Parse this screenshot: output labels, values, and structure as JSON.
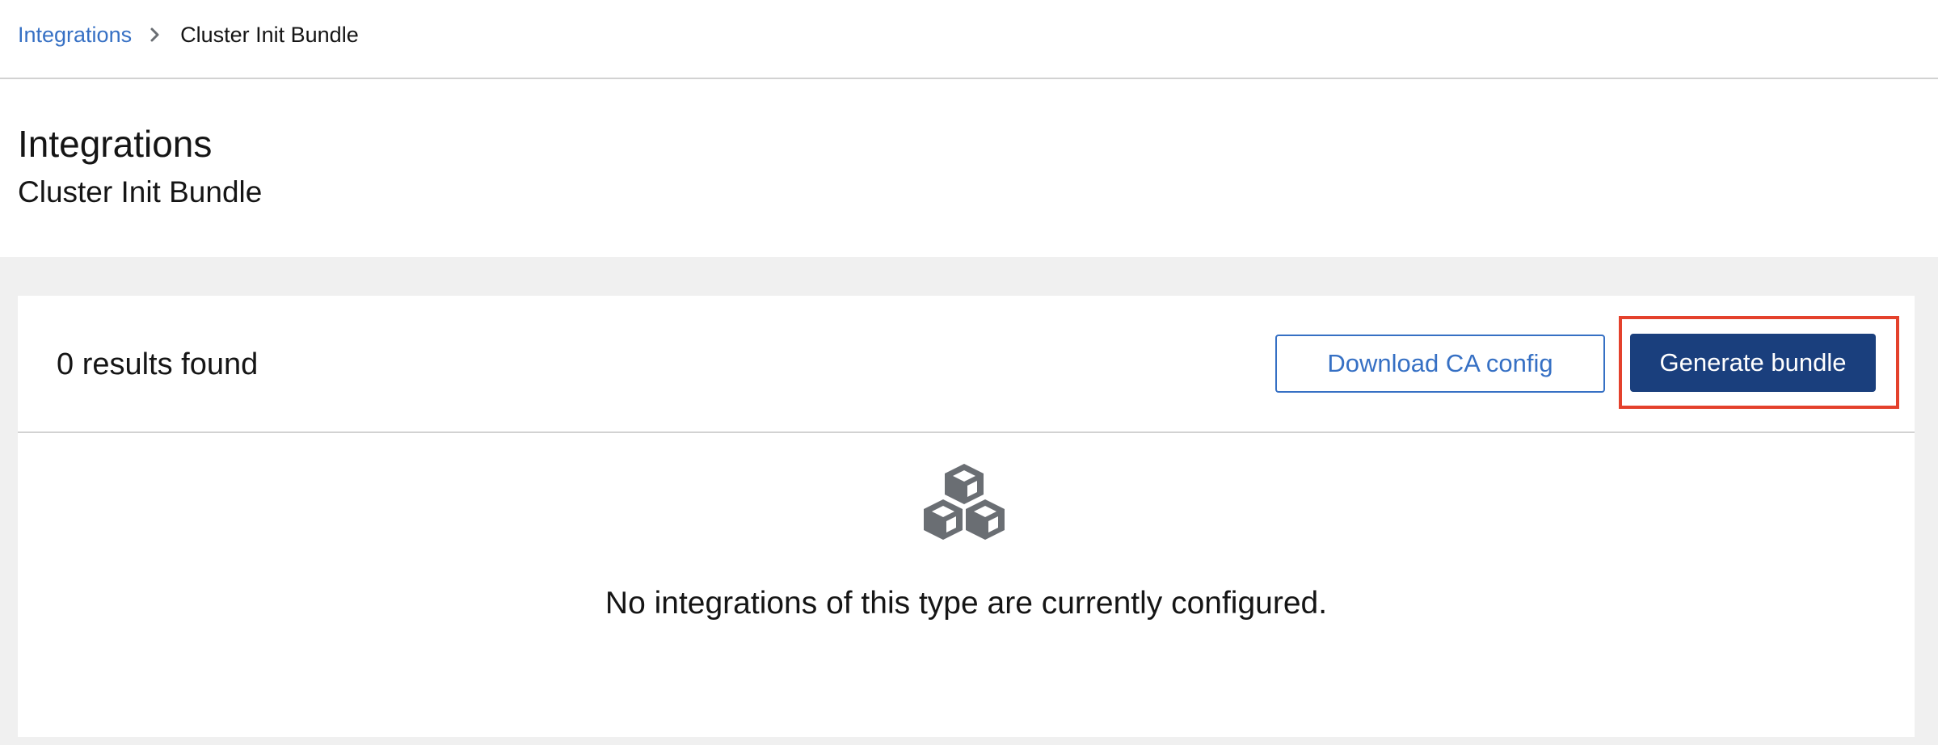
{
  "breadcrumb": {
    "parent": "Integrations",
    "current": "Cluster Init Bundle",
    "separator_icon": "chevron-right-icon"
  },
  "header": {
    "title": "Integrations",
    "subtitle": "Cluster Init Bundle"
  },
  "toolbar": {
    "results_text": "0 results found",
    "download_label": "Download CA config",
    "generate_label": "Generate bundle"
  },
  "empty_state": {
    "icon": "cubes-icon",
    "message": "No integrations of this type are currently configured."
  },
  "colors": {
    "link": "#3670c4",
    "primary_button": "#1a3f7d",
    "highlight": "#e4412c",
    "page_background": "#f0f0f0",
    "icon_gray": "#6a6e73"
  }
}
